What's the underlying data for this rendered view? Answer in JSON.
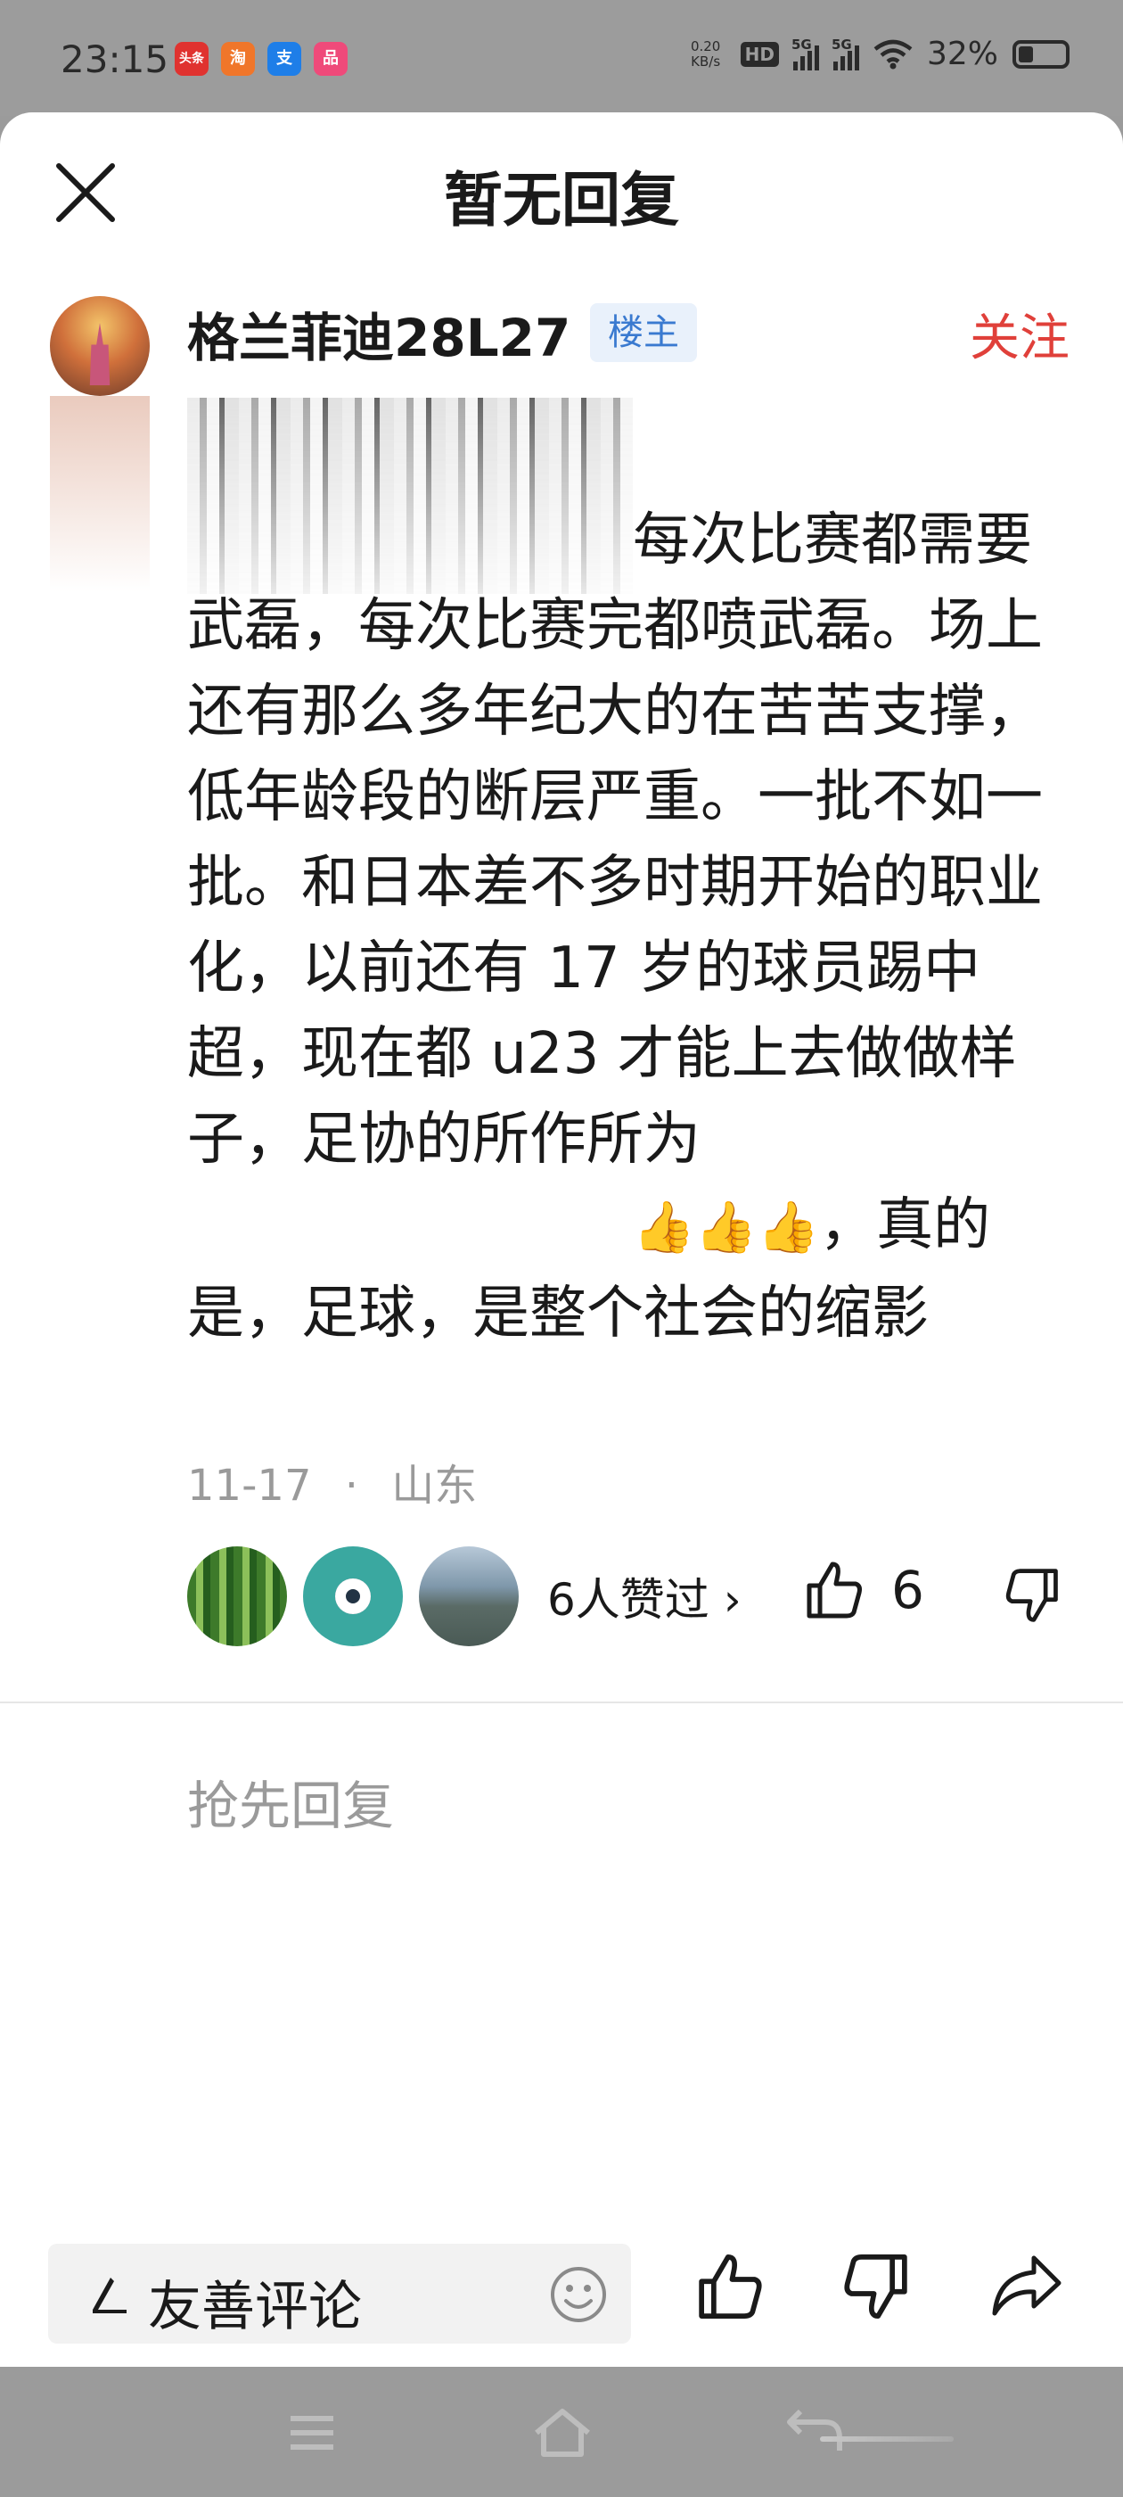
{
  "status_bar": {
    "time": "23:15",
    "app_icons": [
      {
        "name": "toutiao-icon",
        "label": "头条",
        "color": "#e0322f"
      },
      {
        "name": "taobao-icon",
        "label": "淘",
        "color": "#f0762a"
      },
      {
        "name": "alipay-icon",
        "label": "支",
        "color": "#1e7ee8"
      },
      {
        "name": "app-icon",
        "label": "品",
        "color": "#ef4a7a"
      }
    ],
    "net_speed_value": "0.20",
    "net_speed_unit": "KB/s",
    "hd_label": "HD",
    "signal_label": "5G",
    "battery_percent": "32%"
  },
  "header": {
    "title": "暂无回复"
  },
  "comment": {
    "username": "格兰菲迪28L27",
    "owner_badge": "楼主",
    "follow_label": "关注",
    "text": "每次比赛都需要武磊，每次比赛完都喷武磊。场上还有那么多年纪大的在苦苦支撑，低年龄段的断层严重。一批不如一批。和日本差不多时期开始的职业化，以前还有 17 岁的球员踢中超，现在都 u23 才能上去做做样子，足协的所作所为",
    "emoji": "👍👍👍",
    "text_end": "，真的是，足球，是整个社会的缩影",
    "date": "11-17",
    "separator": "·",
    "location": "山东",
    "likers_text": "6人赞过 ›",
    "like_count": "6"
  },
  "replies": {
    "empty_label": "抢先回复"
  },
  "bottom_bar": {
    "input_placeholder": "友善评论"
  },
  "colors": {
    "accent_red": "#e0403a",
    "badge_blue": "#3a7ad0"
  }
}
